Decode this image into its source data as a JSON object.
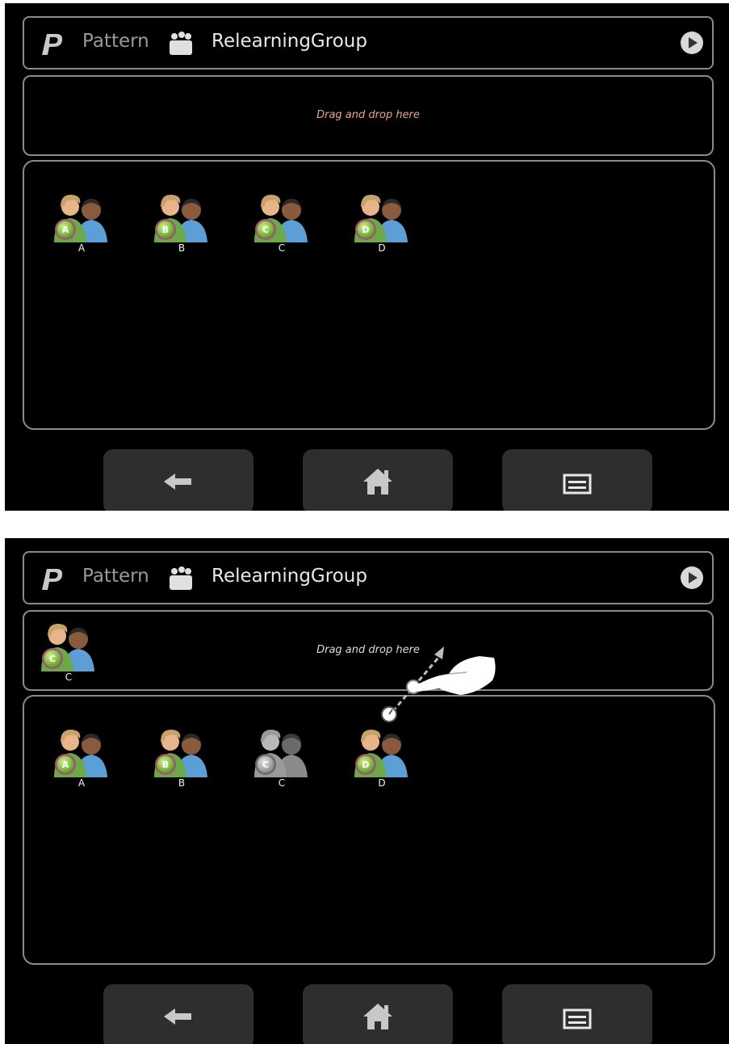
{
  "header": {
    "pattern_label": "Pattern",
    "group_name": "RelearningGroup"
  },
  "dropzone": {
    "placeholder": "Drag and drop here"
  },
  "screen1": {
    "dropped": [],
    "pool": [
      {
        "label": "A",
        "state": "active"
      },
      {
        "label": "B",
        "state": "active"
      },
      {
        "label": "C",
        "state": "active"
      },
      {
        "label": "D",
        "state": "active"
      }
    ]
  },
  "screen2": {
    "dropped": [
      {
        "label": "C",
        "state": "active"
      }
    ],
    "pool": [
      {
        "label": "A",
        "state": "active"
      },
      {
        "label": "B",
        "state": "active"
      },
      {
        "label": "C",
        "state": "disabled"
      },
      {
        "label": "D",
        "state": "active"
      }
    ]
  },
  "icons": {
    "logo": "p-logo-icon",
    "group": "group-icon",
    "play": "play-circle-icon",
    "back": "back-arrow-icon",
    "home": "home-icon",
    "menu": "menu-icon",
    "hand": "drag-hand-icon"
  },
  "colors": {
    "background": "#000000",
    "frame": "#8a8a8a",
    "badge_green": "#7cc242",
    "badge_ring": "#a2566f",
    "nav_button": "#2e2e2e"
  }
}
